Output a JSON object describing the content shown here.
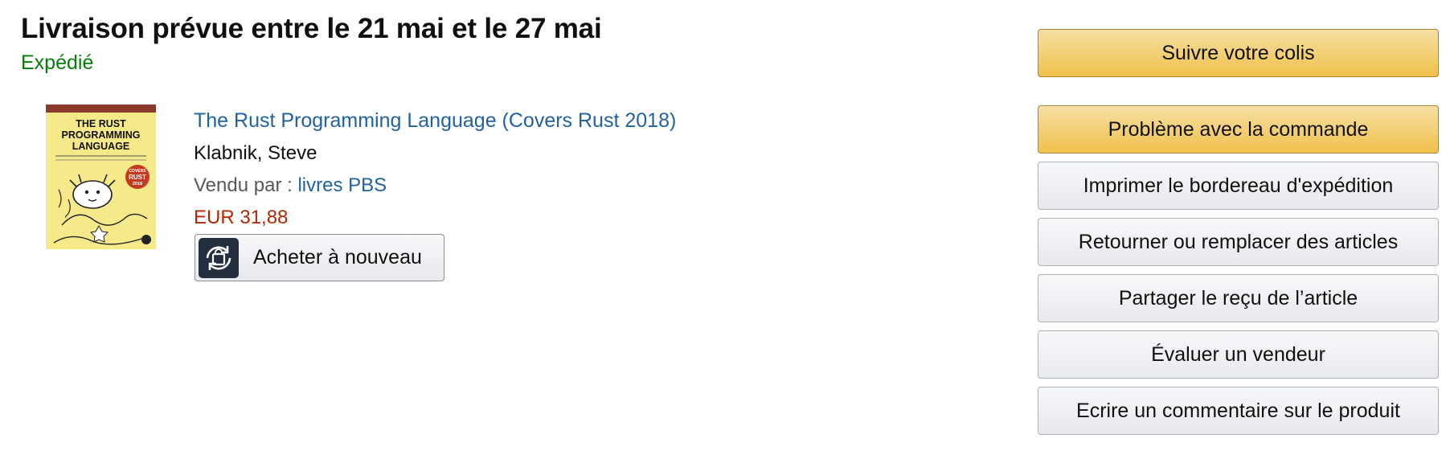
{
  "delivery": {
    "title": "Livraison prévue entre le 21 mai et le 27 mai",
    "status": "Expédié"
  },
  "item": {
    "title": "The Rust Programming Language (Covers Rust 2018)",
    "author": "Klabnik, Steve",
    "seller_prefix": "Vendu par : ",
    "seller_name": "livres PBS",
    "price": "EUR 31,88",
    "buy_again_label": "Acheter à nouveau",
    "buy_again_icon": "buy-again-icon",
    "cover": {
      "title_line1": "THE RUST",
      "title_line2": "PROGRAMMING",
      "title_line3": "LANGUAGE",
      "badge_line1": "COVERS",
      "badge_line2": "RUST",
      "badge_line3": "2018"
    }
  },
  "actions": {
    "track_package": "Suivre votre colis",
    "order_problem": "Problème avec la commande",
    "print_slip": "Imprimer le bordereau d'expédition",
    "return_replace": "Retourner ou remplacer des articles",
    "share_receipt": "Partager le reçu de l’article",
    "rate_seller": "Évaluer un vendeur",
    "write_review": "Ecrire un commentaire sur le produit"
  },
  "colors": {
    "primary_button": "#f0c14b",
    "secondary_button": "#e7e9ec",
    "link": "#2162a1",
    "status_green": "#067d0a",
    "price_red": "#b12704"
  }
}
